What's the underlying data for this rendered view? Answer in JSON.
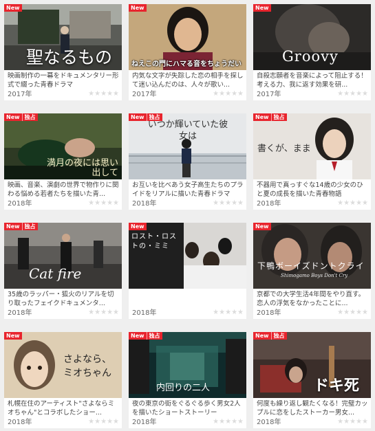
{
  "cards": [
    {
      "badges": [
        "New"
      ],
      "art_title": "聖なるもの",
      "description": "映画制作の一幕をドキュメンタリー形式で綴った青春ドラマ",
      "year": "2017年",
      "stars": "★★★★★"
    },
    {
      "badges": [
        "New"
      ],
      "art_title": "ねえこの門にハマる音をちょうだい",
      "description": "内気な文字が失踪した恋の相手を探して迷い込んだのは、人々が歌い...",
      "year": "2017年",
      "stars": "★★★★★"
    },
    {
      "badges": [
        "New"
      ],
      "art_title": "Groovy",
      "description": "自殺志願者を音楽によって阻止する！考える力、我に返す効果を研...",
      "year": "2017年",
      "stars": "★★★★★"
    },
    {
      "badges": [
        "New",
        "独占"
      ],
      "art_title": "満月の夜には思い出して",
      "description": "映画、音楽、演劇の世界で物作りに関わる悩める若者たちを描いた青...",
      "year": "2018年",
      "stars": "★★★★★"
    },
    {
      "badges": [
        "New",
        "独占"
      ],
      "art_title": "いつか輝いていた彼女は",
      "description": "お互いを比べあう女子高生たちのプライドをリアルに描いた青春ドラマ",
      "year": "2018年",
      "stars": "★★★★★"
    },
    {
      "badges": [
        "New",
        "独占"
      ],
      "art_title": "書くが、まま",
      "description": "不器用で真っすぐな14歳の少女のひと夏の成長を描いた青春物語",
      "year": "2018年",
      "stars": "★★★★★"
    },
    {
      "badges": [
        "New",
        "独占"
      ],
      "art_title": "Cat fire",
      "description": "35歳のラッパー・狐火のリアルを切り取ったフェイクドキュメンタ...",
      "year": "2018年",
      "stars": "★★★★★"
    },
    {
      "badges": [
        "New"
      ],
      "art_title": "ロスト・ロストの・ミミ",
      "description": "",
      "year": "2018年",
      "stars": "★★★★★"
    },
    {
      "badges": [
        "New"
      ],
      "art_title": "下鴨ボーイズドントクライ",
      "subtitle": "Shimogamo Boys Don't Cry",
      "description": "京都での大学生活4年間をやり直す。恋人の浮気をなかったことに...",
      "year": "2018年",
      "stars": "★★★★★"
    },
    {
      "badges": [
        "New"
      ],
      "art_title": "さよなら、ミオちゃん",
      "description": "札幌在住のアーティスト\"さよならミオちゃん\"とコラボしたショー...",
      "year": "2018年",
      "stars": "★★★★★"
    },
    {
      "badges": [
        "New",
        "独占"
      ],
      "art_title": "内回りの二人",
      "description": "夜の東京の街をぐるぐる歩く男女2人を描いたショートストーリー",
      "year": "2018年",
      "stars": "★★★★★"
    },
    {
      "badges": [
        "New",
        "独占"
      ],
      "art_title": "ドキ死",
      "description": "何度も繰り返し観たくなる！完璧カップルに恋をしたストーカー男女...",
      "year": "2018年",
      "stars": "★★★★★"
    }
  ],
  "colors": {
    "badge_red": "#e8242d",
    "page_bg": "#efefef",
    "star_empty": "#dcdcdc"
  }
}
